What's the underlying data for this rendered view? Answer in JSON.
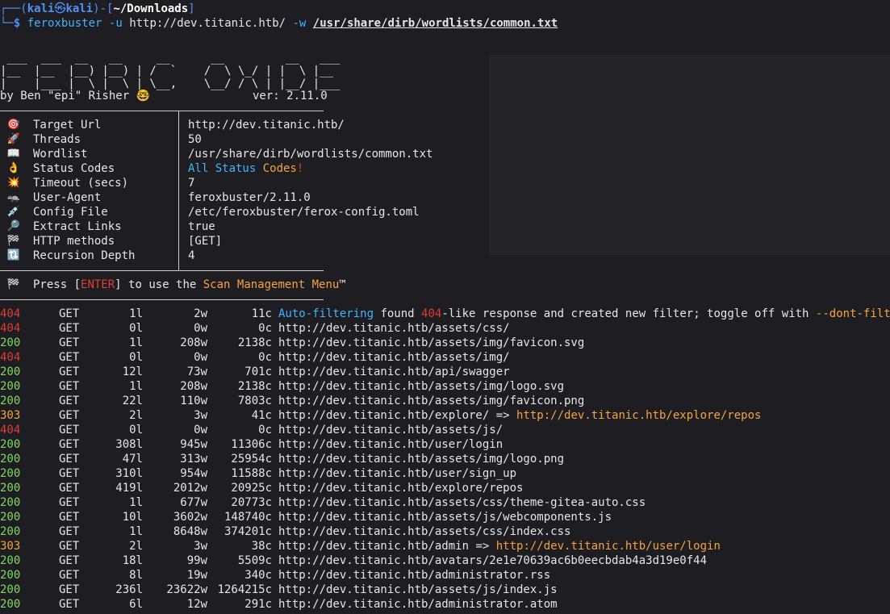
{
  "prompt": {
    "user": "kali",
    "host": "kali",
    "at": "㉿",
    "cwd": "~/Downloads",
    "dollar": "$",
    "command": "feroxbuster",
    "flag_u": "-u",
    "url": "http://dev.titanic.htb/",
    "flag_w": "-w",
    "wordlist": "/usr/share/dirb/wordlists/common.txt"
  },
  "banner": {
    "art_line1": " ___  ___  __   __     __      __         __   ___",
    "art_line2": "|__  |__  |__) |__) | /  `    /  \\ \\_/ | |  \\ |__",
    "art_line3": "|    |___ |  \\ |  \\ | \\__,    \\__/ / \\ | |__/ |___",
    "author": "by Ben \"epi\" Risher 🤓",
    "version": "ver: 2.11.0"
  },
  "config": [
    {
      "icon": "🎯",
      "icon_name": "target-icon",
      "label": "Target Url",
      "value": "http://dev.titanic.htb/"
    },
    {
      "icon": "🚀",
      "icon_name": "rocket-icon",
      "label": "Threads",
      "value": "50"
    },
    {
      "icon": "📖",
      "icon_name": "book-icon",
      "label": "Wordlist",
      "value": "/usr/share/dirb/wordlists/common.txt"
    },
    {
      "icon": "👌",
      "icon_name": "ok-hand-icon",
      "label": "Status Codes",
      "value": ""
    },
    {
      "icon": "💥",
      "icon_name": "collision-icon",
      "label": "Timeout (secs)",
      "value": "7"
    },
    {
      "icon": "🦡",
      "icon_name": "badger-icon",
      "label": "User-Agent",
      "value": "feroxbuster/2.11.0"
    },
    {
      "icon": "💉",
      "icon_name": "syringe-icon",
      "label": "Config File",
      "value": "/etc/feroxbuster/ferox-config.toml"
    },
    {
      "icon": "🔎",
      "icon_name": "magnifier-icon",
      "label": "Extract Links",
      "value": "true"
    },
    {
      "icon": "🏁",
      "icon_name": "checkered-flag-icon",
      "label": "HTTP methods",
      "value": "[GET]"
    },
    {
      "icon": "🔃",
      "icon_name": "reload-icon",
      "label": "Recursion Depth",
      "value": "4"
    }
  ],
  "status_codes_value": {
    "part1": "All Status ",
    "part2": "Codes",
    "part3": "!"
  },
  "menu_hint": {
    "icon": "🏁",
    "pre": "Press [",
    "key": "ENTER",
    "mid": "] to use the ",
    "menu": "Scan Management Menu",
    "tm": "™"
  },
  "results": [
    {
      "status": "404",
      "method": "GET",
      "lines": "1l",
      "words": "2w",
      "chars": "11c",
      "url": "",
      "note": {
        "a": "Auto-filtering",
        "b": " found ",
        "c": "404",
        "d": "-like response and created new filter; toggle off with ",
        "e": "--dont-filter"
      }
    },
    {
      "status": "404",
      "method": "GET",
      "lines": "0l",
      "words": "0w",
      "chars": "0c",
      "url": "http://dev.titanic.htb/assets/css/"
    },
    {
      "status": "200",
      "method": "GET",
      "lines": "1l",
      "words": "208w",
      "chars": "2138c",
      "url": "http://dev.titanic.htb/assets/img/favicon.svg"
    },
    {
      "status": "404",
      "method": "GET",
      "lines": "0l",
      "words": "0w",
      "chars": "0c",
      "url": "http://dev.titanic.htb/assets/img/"
    },
    {
      "status": "200",
      "method": "GET",
      "lines": "12l",
      "words": "73w",
      "chars": "701c",
      "url": "http://dev.titanic.htb/api/swagger"
    },
    {
      "status": "200",
      "method": "GET",
      "lines": "1l",
      "words": "208w",
      "chars": "2138c",
      "url": "http://dev.titanic.htb/assets/img/logo.svg"
    },
    {
      "status": "200",
      "method": "GET",
      "lines": "22l",
      "words": "110w",
      "chars": "7803c",
      "url": "http://dev.titanic.htb/assets/img/favicon.png"
    },
    {
      "status": "303",
      "method": "GET",
      "lines": "2l",
      "words": "3w",
      "chars": "41c",
      "url": "http://dev.titanic.htb/explore/",
      "redirect": "http://dev.titanic.htb/explore/repos"
    },
    {
      "status": "404",
      "method": "GET",
      "lines": "0l",
      "words": "0w",
      "chars": "0c",
      "url": "http://dev.titanic.htb/assets/js/"
    },
    {
      "status": "200",
      "method": "GET",
      "lines": "308l",
      "words": "945w",
      "chars": "11306c",
      "url": "http://dev.titanic.htb/user/login"
    },
    {
      "status": "200",
      "method": "GET",
      "lines": "47l",
      "words": "313w",
      "chars": "25954c",
      "url": "http://dev.titanic.htb/assets/img/logo.png"
    },
    {
      "status": "200",
      "method": "GET",
      "lines": "310l",
      "words": "954w",
      "chars": "11588c",
      "url": "http://dev.titanic.htb/user/sign_up"
    },
    {
      "status": "200",
      "method": "GET",
      "lines": "419l",
      "words": "2012w",
      "chars": "20925c",
      "url": "http://dev.titanic.htb/explore/repos"
    },
    {
      "status": "200",
      "method": "GET",
      "lines": "1l",
      "words": "677w",
      "chars": "20773c",
      "url": "http://dev.titanic.htb/assets/css/theme-gitea-auto.css"
    },
    {
      "status": "200",
      "method": "GET",
      "lines": "10l",
      "words": "3602w",
      "chars": "148740c",
      "url": "http://dev.titanic.htb/assets/js/webcomponents.js"
    },
    {
      "status": "200",
      "method": "GET",
      "lines": "1l",
      "words": "8648w",
      "chars": "374201c",
      "url": "http://dev.titanic.htb/assets/css/index.css"
    },
    {
      "status": "303",
      "method": "GET",
      "lines": "2l",
      "words": "3w",
      "chars": "38c",
      "url": "http://dev.titanic.htb/admin",
      "redirect": "http://dev.titanic.htb/user/login"
    },
    {
      "status": "200",
      "method": "GET",
      "lines": "18l",
      "words": "99w",
      "chars": "5509c",
      "url": "http://dev.titanic.htb/avatars/2e1e70639ac6b0eecbdab4a3d19e0f44"
    },
    {
      "status": "200",
      "method": "GET",
      "lines": "8l",
      "words": "19w",
      "chars": "340c",
      "url": "http://dev.titanic.htb/administrator.rss"
    },
    {
      "status": "200",
      "method": "GET",
      "lines": "236l",
      "words": "23622w",
      "chars": "1264215c",
      "url": "http://dev.titanic.htb/assets/js/index.js"
    },
    {
      "status": "200",
      "method": "GET",
      "lines": "6l",
      "words": "12w",
      "chars": "291c",
      "url": "http://dev.titanic.htb/administrator.atom"
    }
  ],
  "colors": {
    "background": "#1e1e22",
    "prompt_blue": "#4f8ff7",
    "status_200": "#7fd962",
    "status_303": "#f4a340",
    "status_404": "#e03c31",
    "cyan": "#3fb5ff",
    "orange": "#f4a340"
  }
}
